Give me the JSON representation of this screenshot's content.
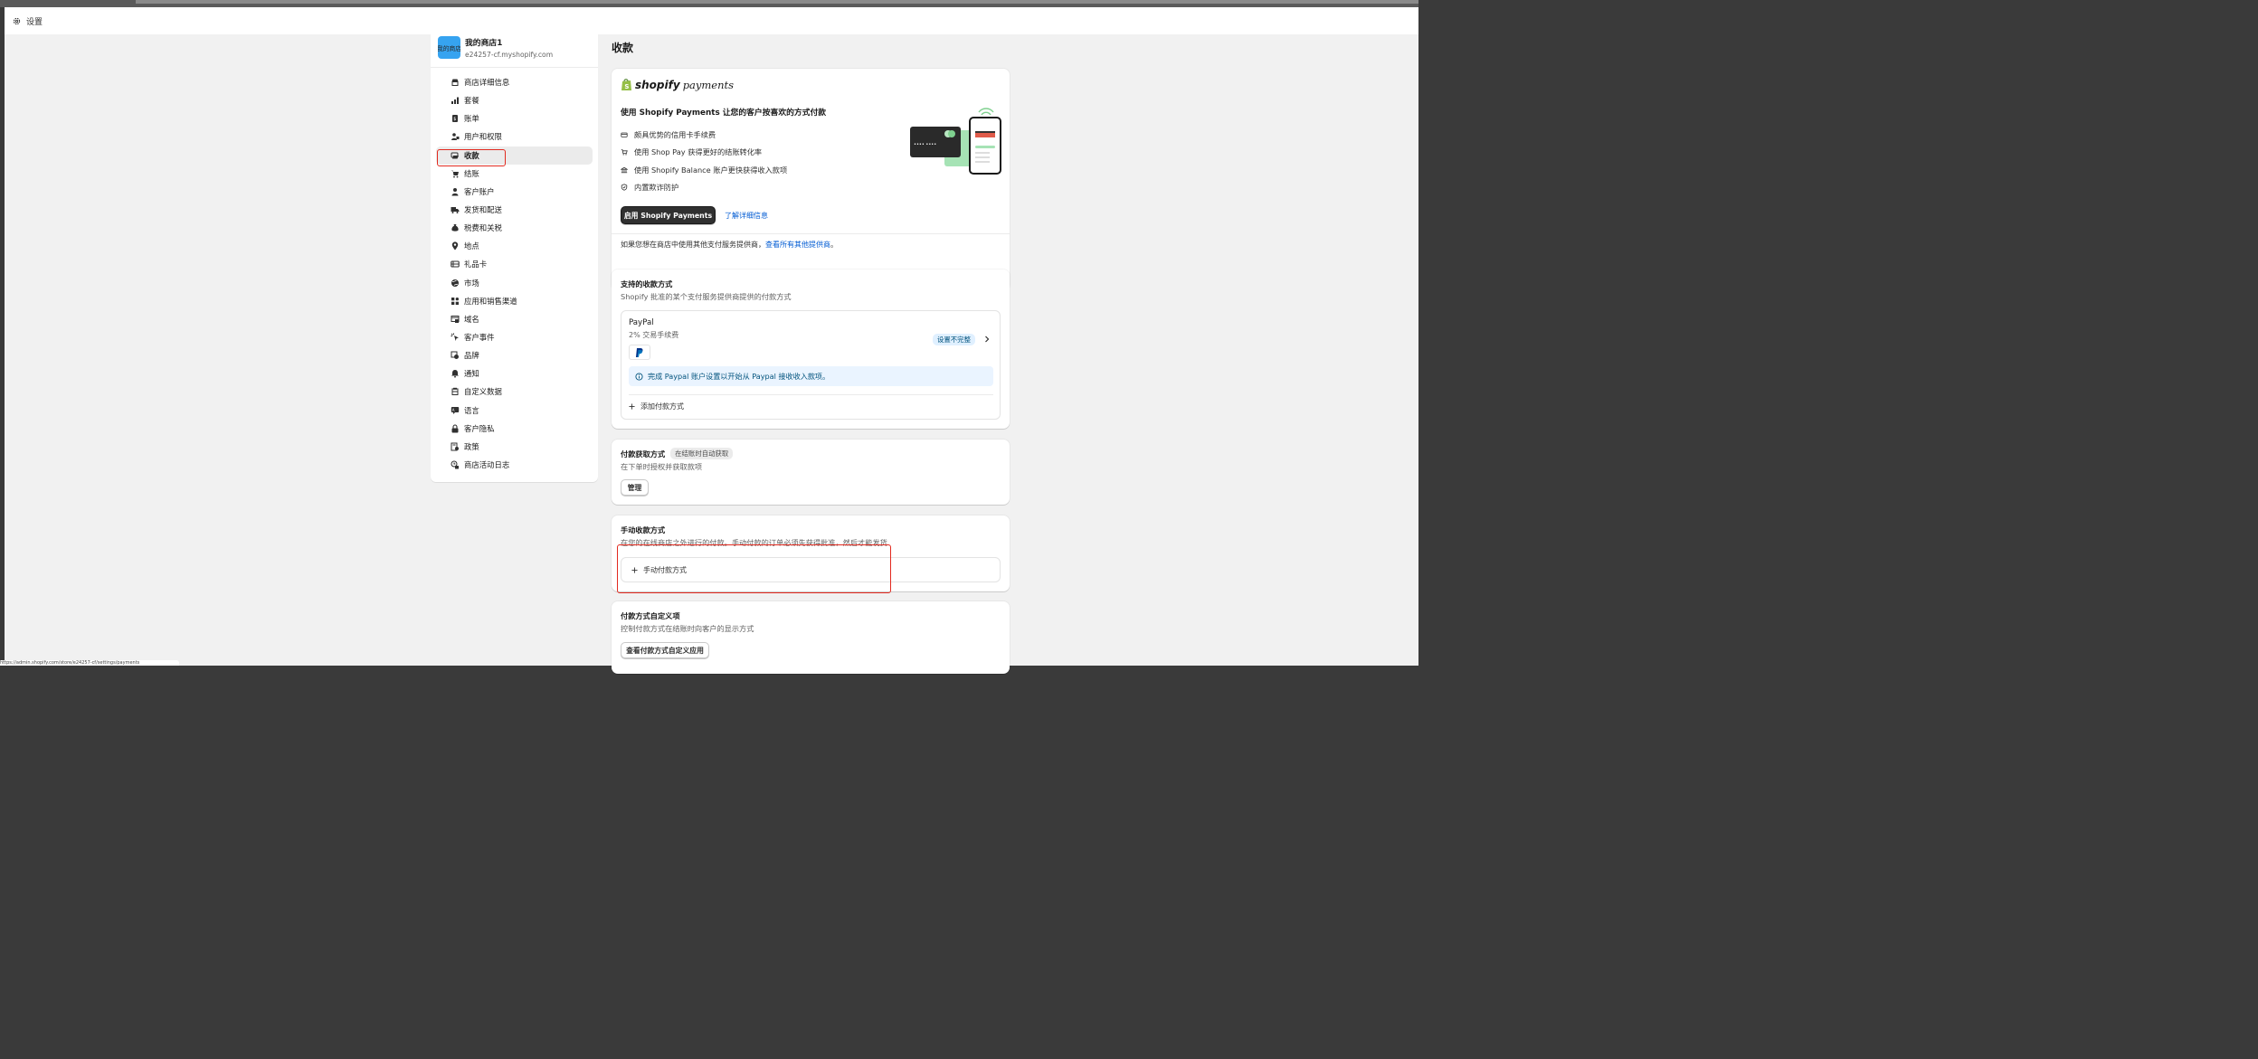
{
  "window": {
    "title": "设置"
  },
  "store": {
    "avatar_text": "我的商店",
    "name": "我的商店1",
    "url": "e24257-cf.myshopify.com"
  },
  "nav": [
    {
      "label": "商店详细信息",
      "icon": "store-icon"
    },
    {
      "label": "套餐",
      "icon": "plan-icon"
    },
    {
      "label": "账单",
      "icon": "billing-icon"
    },
    {
      "label": "用户和权限",
      "icon": "users-icon"
    },
    {
      "label": "收款",
      "icon": "payments-icon",
      "active": true
    },
    {
      "label": "结账",
      "icon": "cart-icon"
    },
    {
      "label": "客户账户",
      "icon": "person-icon"
    },
    {
      "label": "发货和配送",
      "icon": "truck-icon"
    },
    {
      "label": "税费和关税",
      "icon": "tax-icon"
    },
    {
      "label": "地点",
      "icon": "location-icon"
    },
    {
      "label": "礼品卡",
      "icon": "gift-card-icon"
    },
    {
      "label": "市场",
      "icon": "globe-icon"
    },
    {
      "label": "应用和销售渠道",
      "icon": "apps-icon"
    },
    {
      "label": "域名",
      "icon": "domain-icon"
    },
    {
      "label": "客户事件",
      "icon": "cursor-icon"
    },
    {
      "label": "品牌",
      "icon": "brand-icon"
    },
    {
      "label": "通知",
      "icon": "bell-icon"
    },
    {
      "label": "自定义数据",
      "icon": "database-icon"
    },
    {
      "label": "语言",
      "icon": "language-icon"
    },
    {
      "label": "客户隐私",
      "icon": "lock-icon"
    },
    {
      "label": "政策",
      "icon": "policy-icon"
    },
    {
      "label": "商店活动日志",
      "icon": "activity-icon"
    }
  ],
  "main": {
    "title": "收款",
    "shopify_payments": {
      "logo_main": "shopify",
      "logo_sub": "payments",
      "headline": "使用 Shopify Payments 让您的客户按喜欢的方式付款",
      "features": [
        {
          "text": "颇具优势的信用卡手续费",
          "icon": "card-icon"
        },
        {
          "text": "使用 Shop Pay 获得更好的结账转化率",
          "icon": "cart-icon"
        },
        {
          "text": "使用 Shopify Balance 账户更快获得收入款项",
          "icon": "bank-icon"
        },
        {
          "text": "内置欺诈防护",
          "icon": "shield-icon"
        }
      ],
      "activate_button": "启用 Shopify Payments",
      "learn_more": "了解详细信息",
      "card_digits": "•••• ••••",
      "footer_text": "如果您想在商店中使用其他支付服务提供商，",
      "footer_link": "查看所有其他提供商",
      "footer_end": "。"
    },
    "supported": {
      "title": "支持的收款方式",
      "subtitle": "Shopify 批准的某个支付服务提供商提供的付款方式",
      "provider": {
        "name": "PayPal",
        "fee": "2% 交易手续费",
        "status": "设置不完整",
        "notice": "完成 Paypal 账户设置以开始从 Paypal 接收收入款项。"
      },
      "add_method": "添加付款方式"
    },
    "capture": {
      "title": "付款获取方式",
      "badge": "在结账时自动获取",
      "subtitle": "在下单时授权并获取款项",
      "manage_button": "管理"
    },
    "manual": {
      "title": "手动收款方式",
      "subtitle": "在您的在线商店之外进行的付款。手动付款的订单必须先获得批准，然后才能发货",
      "add_manual": "手动付款方式"
    },
    "customizations": {
      "title": "付款方式自定义项",
      "subtitle": "控制付款方式在结账时向客户的显示方式",
      "view_button": "查看付款方式自定义应用"
    }
  },
  "statusbar": {
    "url": "https://admin.shopify.com/store/e24257-cf/settings/payments"
  },
  "colors": {
    "accent": "#005bd3",
    "highlight": "#e22a1f",
    "info_bg": "#eaf4ff",
    "badge_bg": "#e0f0ff"
  }
}
